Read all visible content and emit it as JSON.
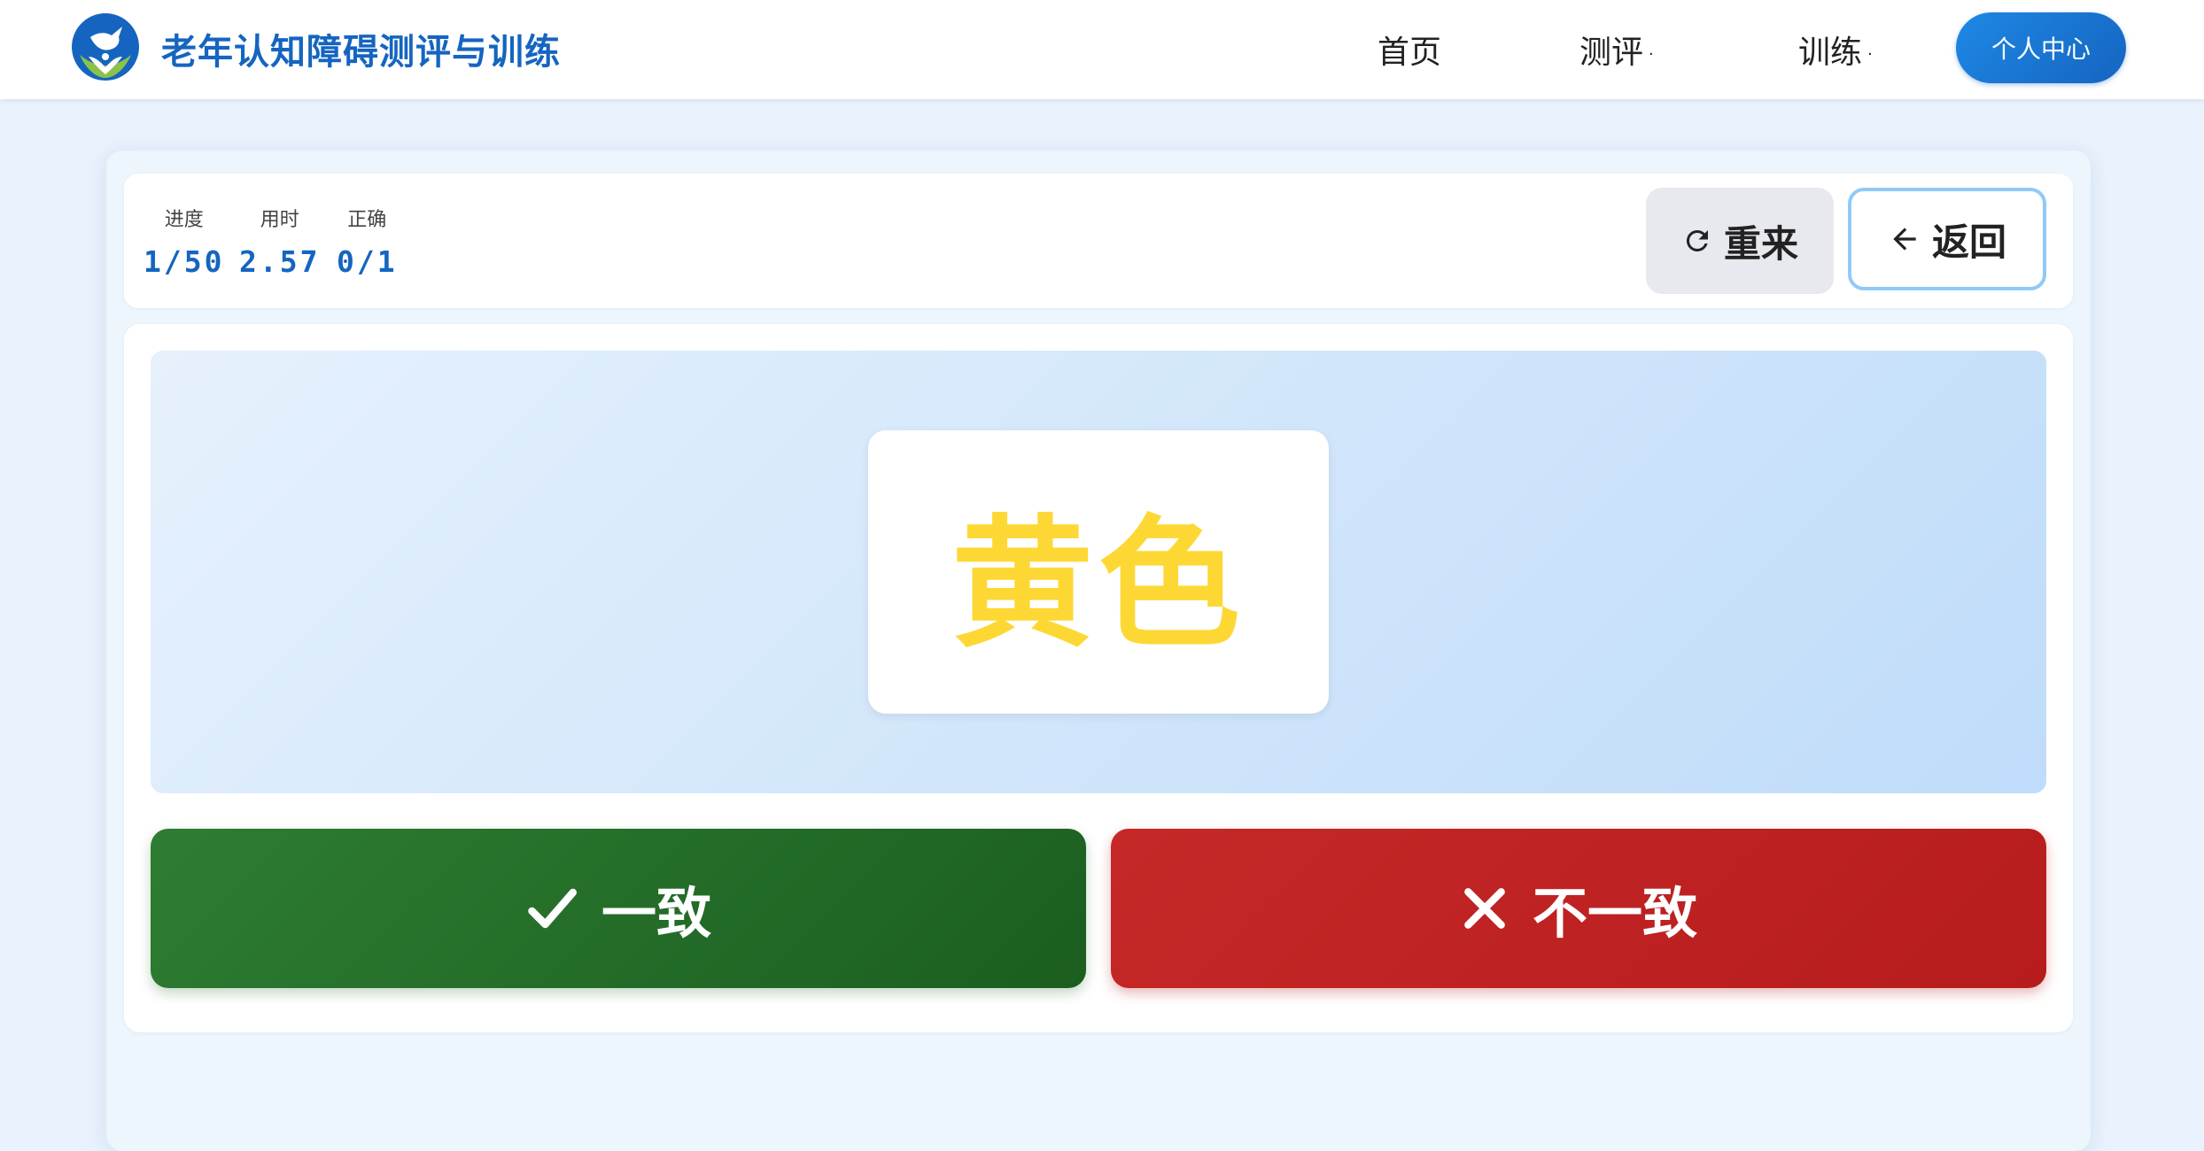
{
  "header": {
    "brand_title": "老年认知障碍测评与训练",
    "logo_icon": "dove-hands-logo",
    "nav": [
      {
        "label": "首页",
        "has_dropdown": false
      },
      {
        "label": "测评",
        "has_dropdown": true
      },
      {
        "label": "训练",
        "has_dropdown": true
      }
    ],
    "profile_label": "个人中心"
  },
  "status": {
    "progress_label": "进度",
    "progress_value": "1/50",
    "time_label": "用时",
    "time_value": "2.57",
    "correct_label": "正确",
    "correct_value": "0/1",
    "restart_label": "重来",
    "restart_icon": "refresh-icon",
    "back_label": "返回",
    "back_icon": "arrow-left-icon"
  },
  "stimulus": {
    "word": "黄色",
    "ink_color": "#fdd835"
  },
  "answers": {
    "consistent_label": "一致",
    "consistent_icon": "check-icon",
    "inconsistent_label": "不一致",
    "inconsistent_icon": "close-icon"
  },
  "colors": {
    "brand": "#1565c0",
    "consistent": "#2e7d32",
    "inconsistent": "#c62828"
  }
}
